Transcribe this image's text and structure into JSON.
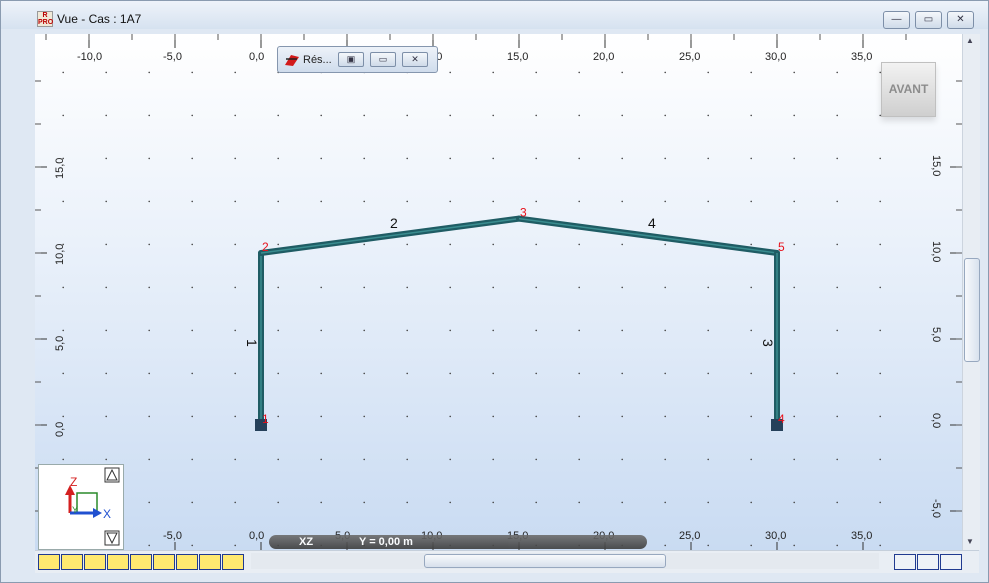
{
  "window": {
    "title": "Vue - Cas : 1A7",
    "app_icon_label": "R PRO",
    "buttons": [
      "minimize",
      "restore",
      "close"
    ]
  },
  "floating_window": {
    "label": "Rés...",
    "icon": "results-icon"
  },
  "view": {
    "orientation_label": "AVANT",
    "plane": "XZ",
    "coordinate": "Y = 0,00 m",
    "axis_x_label": "X",
    "axis_z_label": "Z",
    "axis_y_label": "Y",
    "ruler_top": [
      "-10,0",
      "-5,0",
      "0,0",
      "5,0",
      "10,0",
      "15,0",
      "20,0",
      "25,0",
      "30,0",
      "35,0"
    ],
    "ruler_bottom": [
      "-10,0",
      "-5,0",
      "0,0",
      "5,0",
      "10,0",
      "15,0",
      "20,0",
      "25,0",
      "30,0",
      "35,0"
    ],
    "ruler_side": [
      "15,0",
      "10,0",
      "5,0",
      "0,0",
      "-5,0"
    ]
  },
  "structure": {
    "nodes": [
      {
        "id": "1",
        "x": 0,
        "z": 0,
        "support": true
      },
      {
        "id": "2",
        "x": 0,
        "z": 10
      },
      {
        "id": "3",
        "x": 15,
        "z": 12
      },
      {
        "id": "4",
        "x": 30,
        "z": 0,
        "support": true
      },
      {
        "id": "5",
        "x": 30,
        "z": 10
      }
    ],
    "bars": [
      {
        "id": "1",
        "from": "1",
        "to": "2"
      },
      {
        "id": "2",
        "from": "2",
        "to": "3"
      },
      {
        "id": "4",
        "from": "3",
        "to": "5"
      },
      {
        "id": "3",
        "from": "5",
        "to": "4"
      }
    ]
  },
  "toolbar": {
    "buttons": [
      "node-tool-icon",
      "bar-tool-icon",
      "section-tool-icon",
      "support-tool-icon",
      "load-tool-icon",
      "release-tool-icon",
      "panel-tool-icon",
      "dimension-tool-icon",
      "numbering-tool-icon"
    ],
    "right_buttons": [
      "display-toggle-icon",
      "measure-icon",
      "view-icon"
    ]
  },
  "colors": {
    "bar": "#1f5c64",
    "node_label": "#e8101a",
    "bar_label": "#111111",
    "support": "#25405a"
  }
}
